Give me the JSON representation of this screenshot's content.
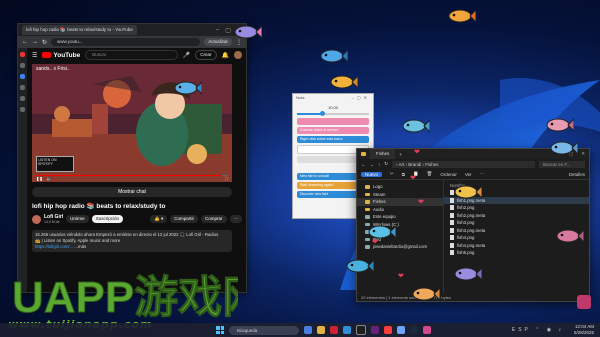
{
  "browser": {
    "tab_title": "lofi hip hop radio 📚 beats to relax/study to - YouTube",
    "url": "www.youtu...",
    "update_button": "Actualizar"
  },
  "youtube": {
    "logo": "YouTube",
    "search_placeholder": "Buscar",
    "create_button": "Crear",
    "video_overlay_title": "sands.. x Frisi..",
    "live_box_text": "LISTEN ON SPOTIFY",
    "progress": 0.97,
    "chat_button": "Mostrar chat",
    "video_title": "lofi hip hop radio 📚 beats to relax/study to",
    "channel_name": "Lofi Girl",
    "channel_subs": "14,9 M de",
    "join_button": "Unirme",
    "subscribed_button": "Suscripción",
    "share_button": "Compartir",
    "buy_button": "Comprar",
    "description_line1": "15.266 usuarios viéndolo ahora  Empezó a emitirse en directo el 12 jul 2022  🎧 Lofi Girl - Radios",
    "description_line2": "📻 | Listen on Spotify, Apple music and more",
    "description_link": "https://lofigirl.com/...",
    "description_more": "...más"
  },
  "notes_app": {
    "title": "Nota",
    "value_label": "10,00",
    "slider_fraction": 0.35,
    "bars": [
      {
        "label": "",
        "color": "pink"
      },
      {
        "label": "Guardar datos al archivo",
        "color": "pink"
      },
      {
        "label": "Right click sobre esta barra",
        "color": "blue"
      },
      {
        "label": "",
        "color": "light"
      },
      {
        "label": "",
        "color": "grey"
      }
    ],
    "bottom_bars": [
      {
        "label": "New fish to unlock!",
        "color": "blue"
      },
      {
        "label": "Start dreaming again!",
        "color": "orange"
      },
      {
        "label": "Discover new fish!",
        "color": "blue"
      }
    ]
  },
  "explorer": {
    "tab_title": "Fishes",
    "breadcrumb": "›  Art  ›  Brandi  ›  Fishes",
    "search_placeholder": "Buscar en F...",
    "toolbar": {
      "new": "Nuevo",
      "sort": "Ordenar",
      "view": "Ver",
      "details": "Detalles"
    },
    "sidebar": [
      {
        "label": "Logo",
        "type": "folder"
      },
      {
        "label": "Steam",
        "type": "folder"
      },
      {
        "label": "Fishes",
        "type": "folder",
        "selected": true
      },
      {
        "label": "Audio",
        "type": "folder"
      },
      {
        "label": "Este equipo",
        "type": "pc"
      },
      {
        "label": "Windows (C:)",
        "type": "drive"
      },
      {
        "label": "DATOS (D:)",
        "type": "drive"
      },
      {
        "label": "Red",
        "type": "net"
      },
      {
        "label": "josedanieltardio@gmail.com",
        "type": "cloud"
      }
    ],
    "column_header": "Nombre",
    "files": [
      {
        "name": "fish1.png"
      },
      {
        "name": "fish1.png.meta",
        "selected": true
      },
      {
        "name": "fish2.png"
      },
      {
        "name": "fish2.png.meta"
      },
      {
        "name": "fish3.png"
      },
      {
        "name": "fish3.png.meta"
      },
      {
        "name": "fish4.png"
      },
      {
        "name": "fish4.png.meta"
      },
      {
        "name": "fish5.png"
      }
    ],
    "status": "22 elementos  |  1 elemento seleccionado  704 bytes"
  },
  "taskbar": {
    "search_placeholder": "Búsqueda",
    "time": "12:04 AM",
    "date": "5/28/2025",
    "tray": "ESP ⌃ ◉ ♪"
  },
  "watermark": {
    "logo": "UAPP游戏网",
    "url": "www.tuijianapp.com"
  },
  "colors": {
    "youtube_red": "#ff0000",
    "accent_blue": "#2e8bd6",
    "pink": "#f08bb0",
    "watermark_green": "#6fbe3a"
  }
}
